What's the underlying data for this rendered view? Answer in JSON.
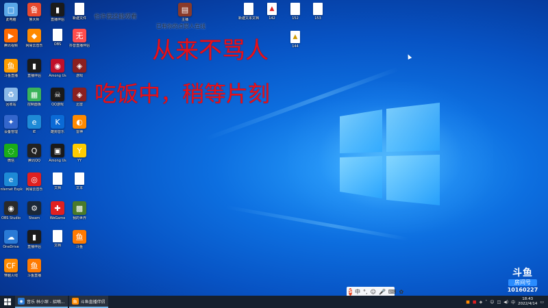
{
  "overlay": {
    "line1": "从来不骂人",
    "line2": "吃饭中，稍等片刻",
    "top_left": "也许我还能观看",
    "top_center": "已有你的点赞人在线",
    "center_icon_label": "主播",
    "center_file_label": "新建文本文档",
    "file_labels": [
      "142",
      "152",
      "153",
      "144"
    ]
  },
  "desktop_icons": [
    {
      "label": "此电脑",
      "icon": "computer-icon",
      "color": "#5aa7e8",
      "ch": "□"
    },
    {
      "label": "鲁大师",
      "icon": "app-icon",
      "color": "#e84a2f",
      "ch": "鲁"
    },
    {
      "label": "直播伴侣",
      "icon": "app-icon",
      "color": "#1b1b1b",
      "ch": "▮"
    },
    {
      "label": "新建文件",
      "icon": "document-icon",
      "color": "#ffffff",
      "ch": ""
    },
    {
      "label": "腾讯视频",
      "icon": "app-icon",
      "color": "#ff6a00",
      "ch": "▶"
    },
    {
      "label": "网易云音乐",
      "icon": "app-icon",
      "color": "#ff8a00",
      "ch": "◆"
    },
    {
      "label": "OBS",
      "icon": "document-icon",
      "color": "#ffffff",
      "ch": ""
    },
    {
      "label": "抖音直播伴侣",
      "icon": "app-icon",
      "color": "#ff4d4d",
      "ch": "无"
    },
    {
      "label": "斗鱼直播",
      "icon": "app-icon",
      "color": "#ff9c00",
      "ch": "鱼"
    },
    {
      "label": "直播伴侣",
      "icon": "app-icon",
      "color": "#1b1b1b",
      "ch": "▮"
    },
    {
      "label": "Among Us",
      "icon": "app-icon",
      "color": "#c0102a",
      "ch": "◉"
    },
    {
      "label": "游戏",
      "icon": "app-icon",
      "color": "#8a2020",
      "ch": "◈"
    },
    {
      "label": "回收站",
      "icon": "recycle-bin-icon",
      "color": "#8ab8e8",
      "ch": "♻"
    },
    {
      "label": "控制面板",
      "icon": "app-icon",
      "color": "#3ab35a",
      "ch": "▦"
    },
    {
      "label": "QQ游戏",
      "icon": "app-icon",
      "color": "#1a1a1a",
      "ch": "☠"
    },
    {
      "label": "迅雷",
      "icon": "app-icon",
      "color": "#8a2020",
      "ch": "◈"
    },
    {
      "label": "设备管理",
      "icon": "app-icon",
      "color": "#3366cc",
      "ch": "✦"
    },
    {
      "label": "IE",
      "icon": "app-icon",
      "color": "#1e8ad6",
      "ch": "e"
    },
    {
      "label": "酷狗音乐",
      "icon": "app-icon",
      "color": "#0a6ad6",
      "ch": "K"
    },
    {
      "label": "雷神",
      "icon": "app-icon",
      "color": "#ff8a00",
      "ch": "◐"
    },
    {
      "label": "微信",
      "icon": "app-icon",
      "color": "#1aad19",
      "ch": "◌"
    },
    {
      "label": "腾讯QQ",
      "icon": "app-icon",
      "color": "#222222",
      "ch": "Q"
    },
    {
      "label": "Among Us",
      "icon": "app-icon",
      "color": "#1a1a1a",
      "ch": "▣"
    },
    {
      "label": "YY",
      "icon": "app-icon",
      "color": "#ffcc00",
      "ch": "Y"
    },
    {
      "label": "Internet Explorer",
      "icon": "app-icon",
      "color": "#1e8ad6",
      "ch": "e"
    },
    {
      "label": "网易云音乐",
      "icon": "app-icon",
      "color": "#e02020",
      "ch": "◎"
    },
    {
      "label": "文档",
      "icon": "document-icon",
      "color": "#ffffff",
      "ch": ""
    },
    {
      "label": "文本",
      "icon": "document-icon",
      "color": "#ffffff",
      "ch": ""
    },
    {
      "label": "OBS Studio",
      "icon": "app-icon",
      "color": "#2a2a2a",
      "ch": "◉"
    },
    {
      "label": "Steam",
      "icon": "app-icon",
      "color": "#1b2838",
      "ch": "⚙"
    },
    {
      "label": "WeGame",
      "icon": "app-icon",
      "color": "#e02020",
      "ch": "✚"
    },
    {
      "label": "我的世界",
      "icon": "app-icon",
      "color": "#4a7a2a",
      "ch": "▩"
    },
    {
      "label": "OneDrive",
      "icon": "app-icon",
      "color": "#2a7ad6",
      "ch": "☁"
    },
    {
      "label": "直播伴侣",
      "icon": "app-icon",
      "color": "#1b1b1b",
      "ch": "▮"
    },
    {
      "label": "文档",
      "icon": "document-icon",
      "color": "#ffffff",
      "ch": ""
    },
    {
      "label": "斗鱼",
      "icon": "app-icon",
      "color": "#ff7a00",
      "ch": "鱼"
    },
    {
      "label": "穿越火线",
      "icon": "app-icon",
      "color": "#ff8a00",
      "ch": "CF"
    },
    {
      "label": "斗鱼直播",
      "icon": "app-icon",
      "color": "#ff7a00",
      "ch": "鱼"
    }
  ],
  "taskbar": {
    "items": [
      {
        "label": "音乐 林小琛 - 招嘀...",
        "color": "#2a7ad6",
        "ch": "◉"
      },
      {
        "label": "斗鱼直播伴侣",
        "color": "#ff8a00",
        "ch": "鱼"
      }
    ],
    "time": "18:43",
    "date": "2022/4/14"
  },
  "ime": {
    "label": "S",
    "items": [
      "中",
      "°,",
      "☺",
      "🎤",
      "⌨",
      "✿"
    ]
  },
  "watermark": {
    "brand": "斗鱼",
    "sub": "房间号",
    "room": "10160227"
  },
  "colors": {
    "overlay_red": "#e8101a",
    "taskbar": "#16202e",
    "accent": "#2a8cff"
  }
}
